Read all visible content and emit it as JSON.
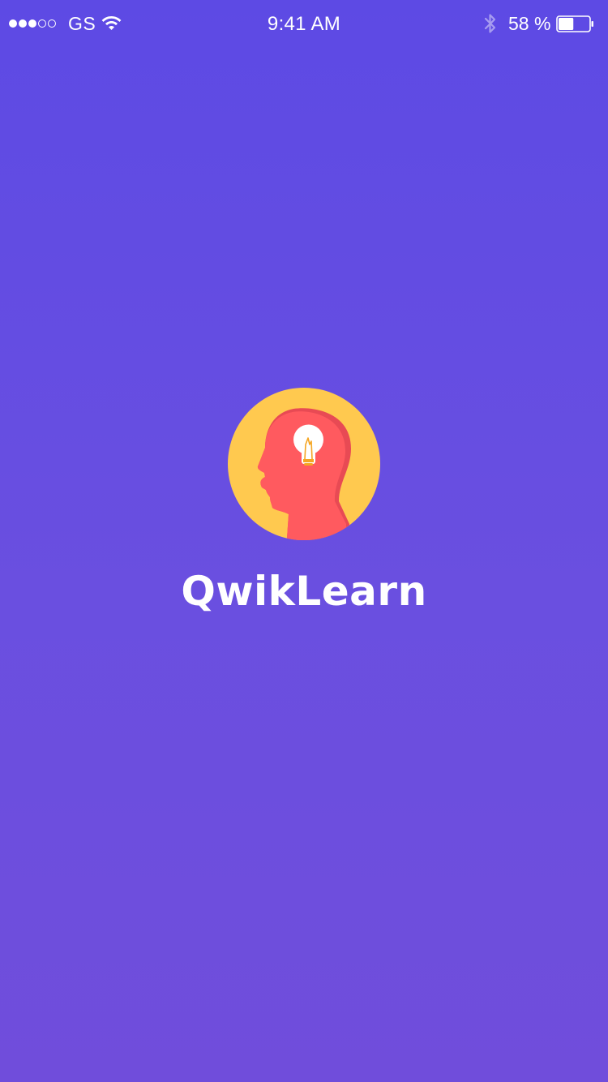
{
  "status_bar": {
    "carrier": "GS",
    "signal_strength": {
      "filled": 3,
      "total": 5
    },
    "time": "9:41 AM",
    "battery_percent_label": "58 %",
    "battery_level": 0.58,
    "icons": [
      "signal-dots-icon",
      "wifi-icon",
      "bluetooth-icon",
      "battery-icon"
    ]
  },
  "splash": {
    "logo_icon": "head-lightbulb-icon",
    "app_name": "QwikLearn"
  },
  "colors": {
    "background_top": "#5d4ae4",
    "background_bottom": "#704ddb",
    "logo_circle": "#ffc94f",
    "logo_head": "#ff5a5f",
    "text": "#ffffff"
  }
}
